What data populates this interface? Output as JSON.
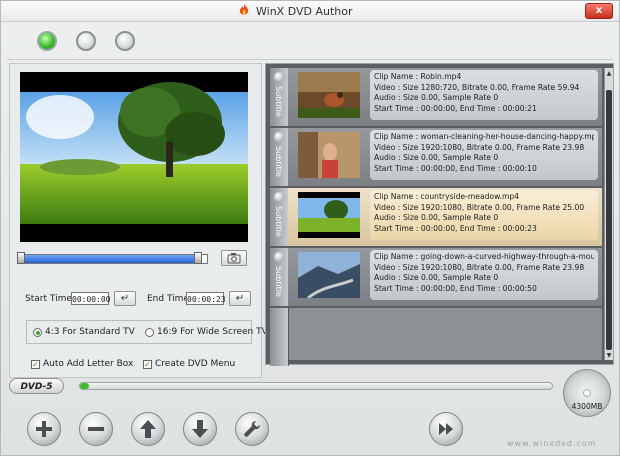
{
  "window": {
    "title": "WinX DVD Author",
    "close_label": "x"
  },
  "preview": {
    "seek_fraction": 0.95
  },
  "times": {
    "start_label": "Start Time :",
    "start_value": "00:00:00",
    "end_label": "End Time :",
    "end_value": "00:00:23",
    "enter_glyph": "↵"
  },
  "aspect": {
    "standard_label": "4:3 For Standard TV",
    "wide_label": "16:9 For Wide Screen TV",
    "selected": "standard"
  },
  "options": {
    "letterbox_label": "Auto Add Letter Box",
    "letterbox_checked": true,
    "menu_label": "Create DVD Menu",
    "menu_checked": true
  },
  "subtitle_label": "Subtitle",
  "clips": [
    {
      "name": "Clip Name : Robin.mp4",
      "video": "Video : Size 1280:720, Bitrate 0.00, Frame Rate 59.94",
      "audio": "Audio : Size 0.00, Sample Rate 0",
      "time": "Start Time : 00:00:00, End Time : 00:00:21"
    },
    {
      "name": "Clip Name : woman-cleaning-her-house-dancing-happy.mp",
      "video": "Video : Size 1920:1080, Bitrate 0.00, Frame Rate 23.98",
      "audio": "Audio : Size 0.00, Sample Rate 0",
      "time": "Start Time : 00:00:00, End Time : 00:00:10"
    },
    {
      "name": "Clip Name : countryside-meadow.mp4",
      "video": "Video : Size 1920:1080, Bitrate 0.00, Frame Rate 25.00",
      "audio": "Audio : Size 0.00, Sample Rate 0",
      "time": "Start Time : 00:00:00, End Time : 00:00:23"
    },
    {
      "name": "Clip Name : going-down-a-curved-highway-through-a-mou",
      "video": "Video : Size 1920:1080, Bitrate 0.00, Frame Rate 23.98",
      "audio": "Audio : Size 0.00, Sample Rate 0",
      "time": "Start Time : 00:00:00, End Time : 00:00:50"
    }
  ],
  "selected_clip": 2,
  "disc": {
    "type_label": "DVD-5",
    "capacity_label": "4300MB",
    "used_fraction": 0.02
  },
  "bottom_buttons": {
    "add_glyph": "+",
    "remove_glyph": "−"
  },
  "brand": "www.winxdvd.com",
  "colors": {
    "accent_green": "#3fbe2a",
    "selected_clip": "#ead6a8",
    "close_red": "#c9301f"
  }
}
